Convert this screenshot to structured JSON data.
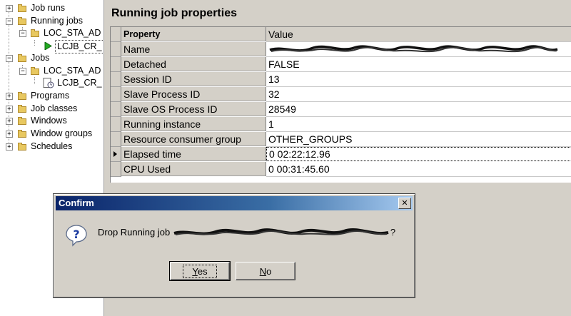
{
  "tree": {
    "items": [
      {
        "label": "Job runs"
      },
      {
        "label": "Running jobs"
      },
      {
        "label": "LOC_STA_AD"
      },
      {
        "label": "LCJB_CR_"
      },
      {
        "label": "Jobs"
      },
      {
        "label": "LOC_STA_AD"
      },
      {
        "label": "LCJB_CR_"
      },
      {
        "label": "Programs"
      },
      {
        "label": "Job classes"
      },
      {
        "label": "Windows"
      },
      {
        "label": "Window groups"
      },
      {
        "label": "Schedules"
      }
    ]
  },
  "panel": {
    "title": "Running job properties",
    "header": {
      "property": "Property",
      "value": "Value"
    },
    "rows": [
      {
        "property": "Name",
        "value": ""
      },
      {
        "property": "Detached",
        "value": "FALSE"
      },
      {
        "property": "Session ID",
        "value": "13"
      },
      {
        "property": "Slave Process ID",
        "value": "32"
      },
      {
        "property": "Slave OS Process ID",
        "value": "28549"
      },
      {
        "property": "Running instance",
        "value": "1"
      },
      {
        "property": "Resource consumer group",
        "value": "OTHER_GROUPS"
      },
      {
        "property": "Elapsed time",
        "value": "0 02:22:12.96"
      },
      {
        "property": "CPU Used",
        "value": "0 00:31:45.60"
      }
    ]
  },
  "dialog": {
    "title": "Confirm",
    "message_prefix": "Drop Running job",
    "message_suffix": "?",
    "yes_label": "Yes",
    "no_label": "No",
    "close_glyph": "✕"
  }
}
